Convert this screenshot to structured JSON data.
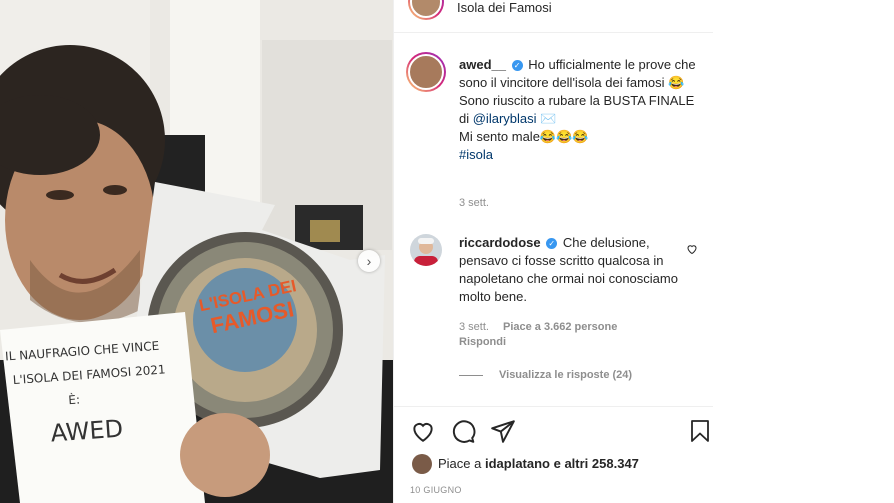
{
  "post": {
    "header_subtitle": "Isola dei Famosi",
    "caption": {
      "username": "awed__",
      "line1": "Ho ufficialmente le prove che sono il vincitore dell'isola dei famosi 😂",
      "line2_pre": "Sono riuscito a rubare la BUSTA FINALE di ",
      "mention": "@ilaryblasi",
      "line2_post": " ✉️",
      "line3": "Mi sento male😂😂😂",
      "hashtag": "#isola",
      "time": "3 sett."
    },
    "comment": {
      "username": "riccardodose",
      "text": "Che delusione, pensavo ci fosse scritto qualcosa in napoletano che ormai noi conosciamo molto bene.",
      "time": "3 sett.",
      "likes": "Piace a 3.662 persone",
      "reply": "Rispondi",
      "view_replies": "Visualizza le risposte (24)"
    },
    "likes": {
      "prefix": "Piace a ",
      "user": "idaplatano",
      "suffix": " e altri 258.347"
    },
    "date": "10 GIUGNO",
    "photo": {
      "card_lines": [
        "IL NAUFRAGIO CHE VINCE",
        "L'ISOLA DEI FAMOSI 2021",
        "È:",
        "AWED"
      ],
      "logo_text": [
        "L'ISOLA DEI",
        "FAMOSI"
      ]
    }
  },
  "colors": {
    "verified": "#3897f0",
    "link": "#00376b",
    "muted": "#8e8e8e"
  }
}
